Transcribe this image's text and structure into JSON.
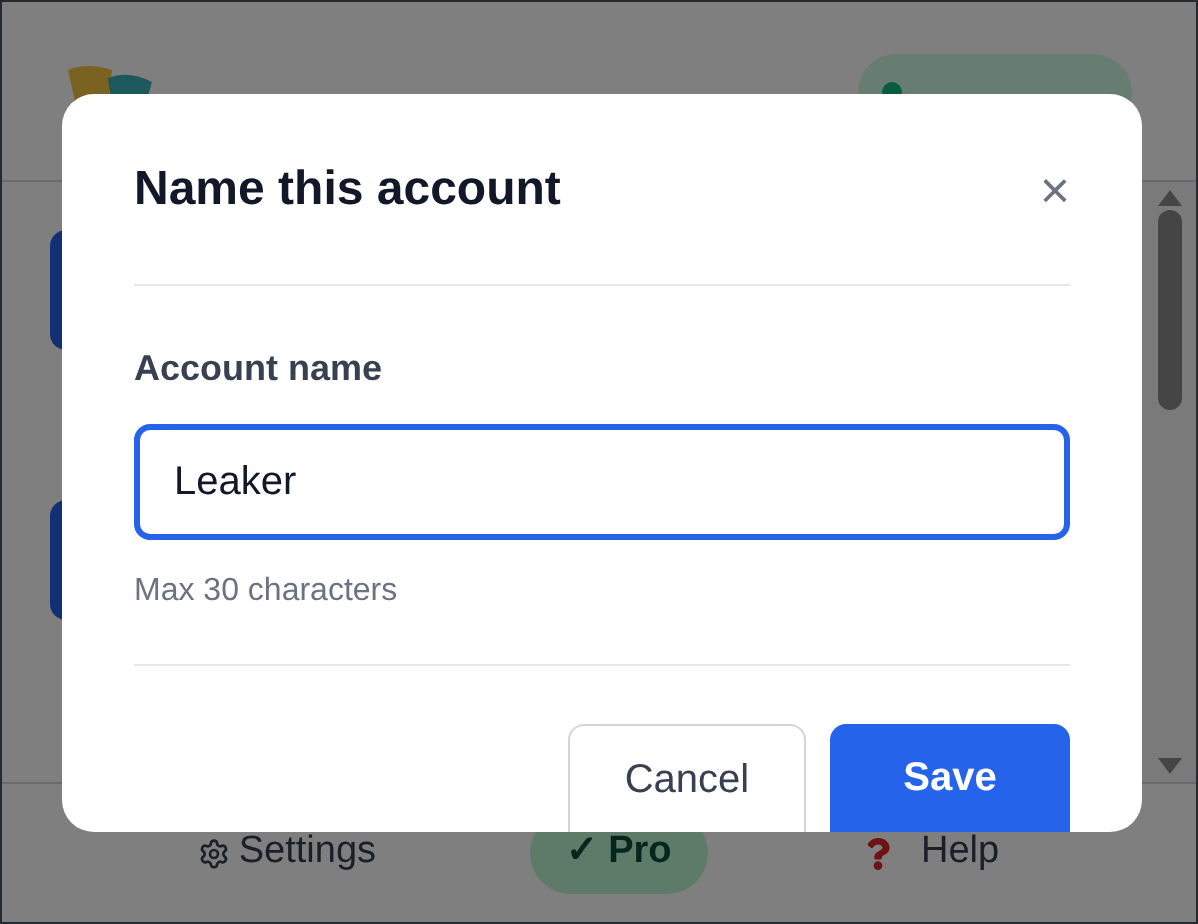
{
  "app": {
    "footer": [
      {
        "kind": "settings",
        "label": "Settings"
      },
      {
        "kind": "plan",
        "label": "✓ Pro"
      },
      {
        "kind": "help",
        "label": "Help"
      }
    ]
  },
  "dialog": {
    "title": "Name this account",
    "close": "×",
    "field_label": "Account name",
    "value": "Leaker",
    "hint": "Max 30 characters",
    "buttons": [
      {
        "kind": "secondary",
        "label": "Cancel"
      },
      {
        "kind": "primary",
        "label": "Save"
      }
    ]
  }
}
